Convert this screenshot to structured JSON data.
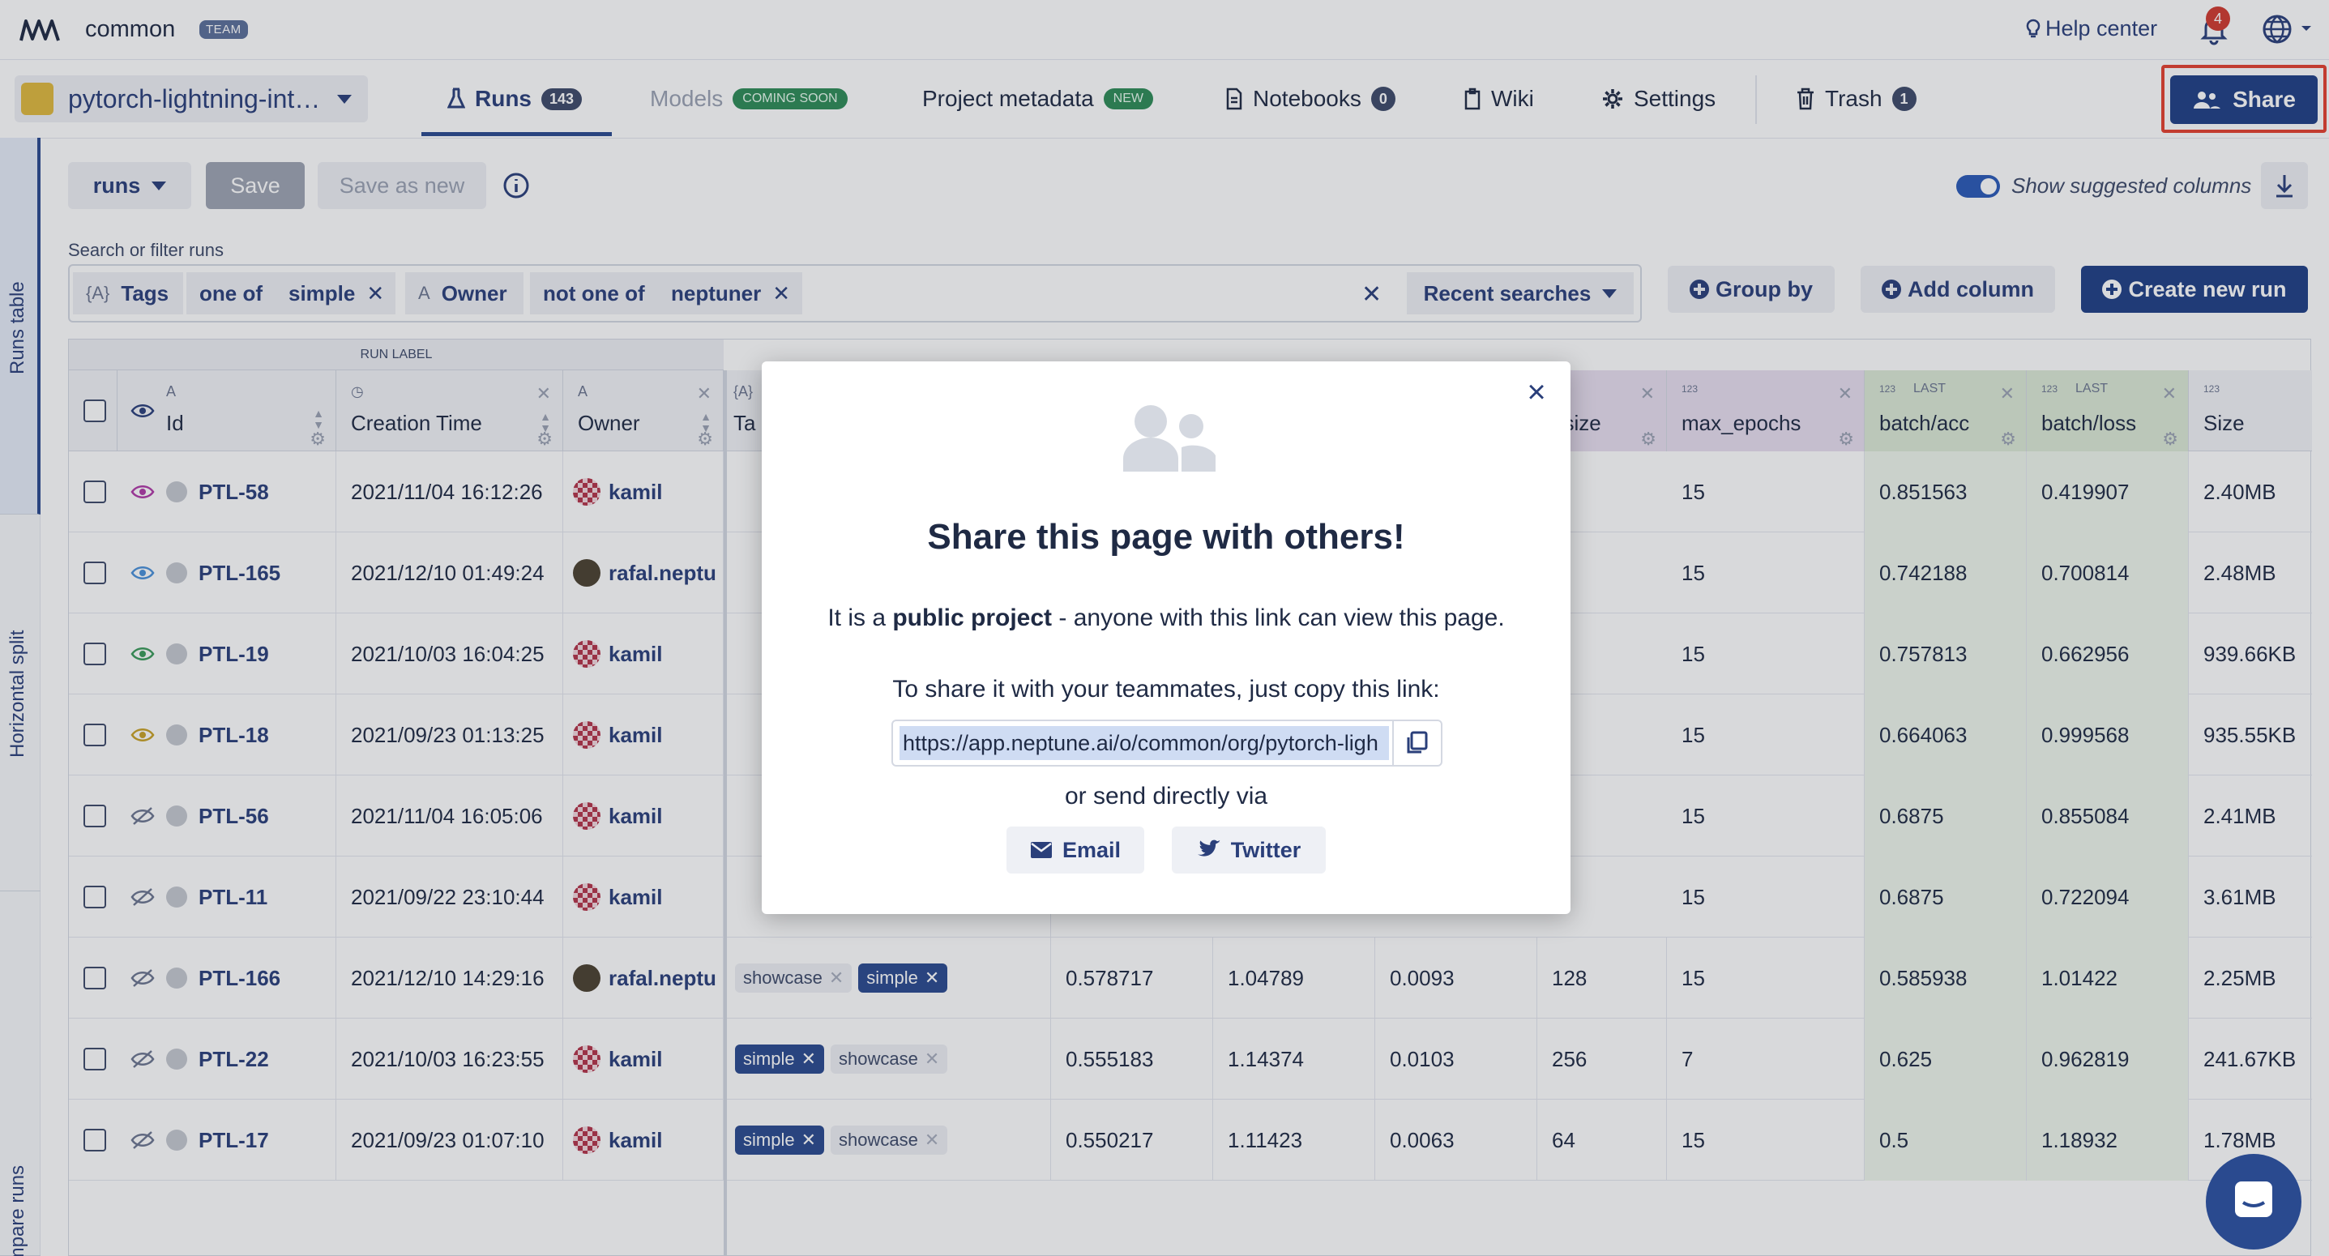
{
  "org": {
    "name": "common",
    "badge": "TEAM"
  },
  "topbar": {
    "help_label": "Help center",
    "notifications_count": "4"
  },
  "project": {
    "name": "pytorch-lightning-int…"
  },
  "tabs": [
    {
      "label": "Runs",
      "count": "143"
    },
    {
      "label": "Models",
      "badge": "COMING SOON"
    },
    {
      "label": "Project metadata",
      "badge": "NEW"
    },
    {
      "label": "Notebooks",
      "count": "0"
    },
    {
      "label": "Wiki"
    },
    {
      "label": "Settings"
    },
    {
      "label": "Trash",
      "count": "1"
    }
  ],
  "share_label": "Share",
  "rail": {
    "items": [
      "Runs table",
      "Horizontal split",
      "Compare runs"
    ]
  },
  "toolbar": {
    "runs_label": "runs",
    "save_label": "Save",
    "save_as_new_label": "Save as new",
    "suggested_label": "Show suggested columns"
  },
  "search": {
    "label": "Search or filter runs",
    "chips": [
      "{A}",
      "Tags",
      "one of",
      "simple",
      "A",
      "Owner",
      "not one of",
      "neptuner"
    ],
    "recent_label": "Recent searches"
  },
  "actions": {
    "group_by": "Group by",
    "add_column": "Add column",
    "create_run": "Create new run"
  },
  "table": {
    "group_header": "RUN LABEL",
    "columns": {
      "id": "Id",
      "creation": "Creation Time",
      "owner": "Owner",
      "tags": "Ta",
      "size_partial": "_size",
      "max_epochs": "max_epochs",
      "batch_acc": "batch/acc",
      "batch_loss": "batch/loss",
      "size": "Size",
      "last": "LAST",
      "num_icon": "123"
    },
    "rows": [
      {
        "id": "PTL-58",
        "time": "2021/11/04 16:12:26",
        "owner": "kamil",
        "max_epochs": "15",
        "acc": "0.851563",
        "loss": "0.419907",
        "size": "2.40MB",
        "eye": "#b03aa8"
      },
      {
        "id": "PTL-165",
        "time": "2021/12/10 01:49:24",
        "owner": "rafal.neptu",
        "max_epochs": "15",
        "acc": "0.742188",
        "loss": "0.700814",
        "size": "2.48MB",
        "eye": "#4a90d9"
      },
      {
        "id": "PTL-19",
        "time": "2021/10/03 16:04:25",
        "owner": "kamil",
        "max_epochs": "15",
        "acc": "0.757813",
        "loss": "0.662956",
        "size": "939.66KB",
        "eye": "#3a9a5a"
      },
      {
        "id": "PTL-18",
        "time": "2021/09/23 01:13:25",
        "owner": "kamil",
        "max_epochs": "15",
        "acc": "0.664063",
        "loss": "0.999568",
        "size": "935.55KB",
        "eye": "#c9a227"
      },
      {
        "id": "PTL-56",
        "time": "2021/11/04 16:05:06",
        "owner": "kamil",
        "max_epochs": "15",
        "acc": "0.6875",
        "loss": "0.855084",
        "size": "2.41MB",
        "eye": ""
      },
      {
        "id": "PTL-11",
        "time": "2021/09/22 23:10:44",
        "owner": "kamil",
        "max_epochs": "15",
        "acc": "0.6875",
        "loss": "0.722094",
        "size": "3.61MB",
        "eye": ""
      },
      {
        "id": "PTL-166",
        "time": "2021/12/10 14:29:16",
        "owner": "rafal.neptu",
        "tags": [
          "showcase",
          "simple"
        ],
        "c1": "0.578717",
        "c2": "1.04789",
        "c3": "0.0093",
        "c4": "128",
        "max_epochs": "15",
        "acc": "0.585938",
        "loss": "1.01422",
        "size": "2.25MB",
        "eye": ""
      },
      {
        "id": "PTL-22",
        "time": "2021/10/03 16:23:55",
        "owner": "kamil",
        "tags": [
          "simple",
          "showcase"
        ],
        "c1": "0.555183",
        "c2": "1.14374",
        "c3": "0.0103",
        "c4": "256",
        "max_epochs": "7",
        "acc": "0.625",
        "loss": "0.962819",
        "size": "241.67KB",
        "eye": ""
      },
      {
        "id": "PTL-17",
        "time": "2021/09/23 01:07:10",
        "owner": "kamil",
        "tags": [
          "simple",
          "showcase"
        ],
        "c1": "0.550217",
        "c2": "1.11423",
        "c3": "0.0063",
        "c4": "64",
        "max_epochs": "15",
        "acc": "0.5",
        "loss": "1.18932",
        "size": "1.78MB",
        "eye": ""
      }
    ]
  },
  "modal": {
    "title": "Share this page with others!",
    "line1_pre": "It is a ",
    "line1_bold": "public project",
    "line1_post": " - anyone with this link can view this page.",
    "line2": "To share it with your teammates, just copy this link:",
    "link": "https://app.neptune.ai/o/common/org/pytorch-ligh",
    "line3": "or send directly via",
    "email_label": "Email",
    "twitter_label": "Twitter"
  },
  "colors": {
    "primary": "#1f3f85",
    "accent_red": "#e5402f",
    "badge_green": "#2e8b57"
  }
}
